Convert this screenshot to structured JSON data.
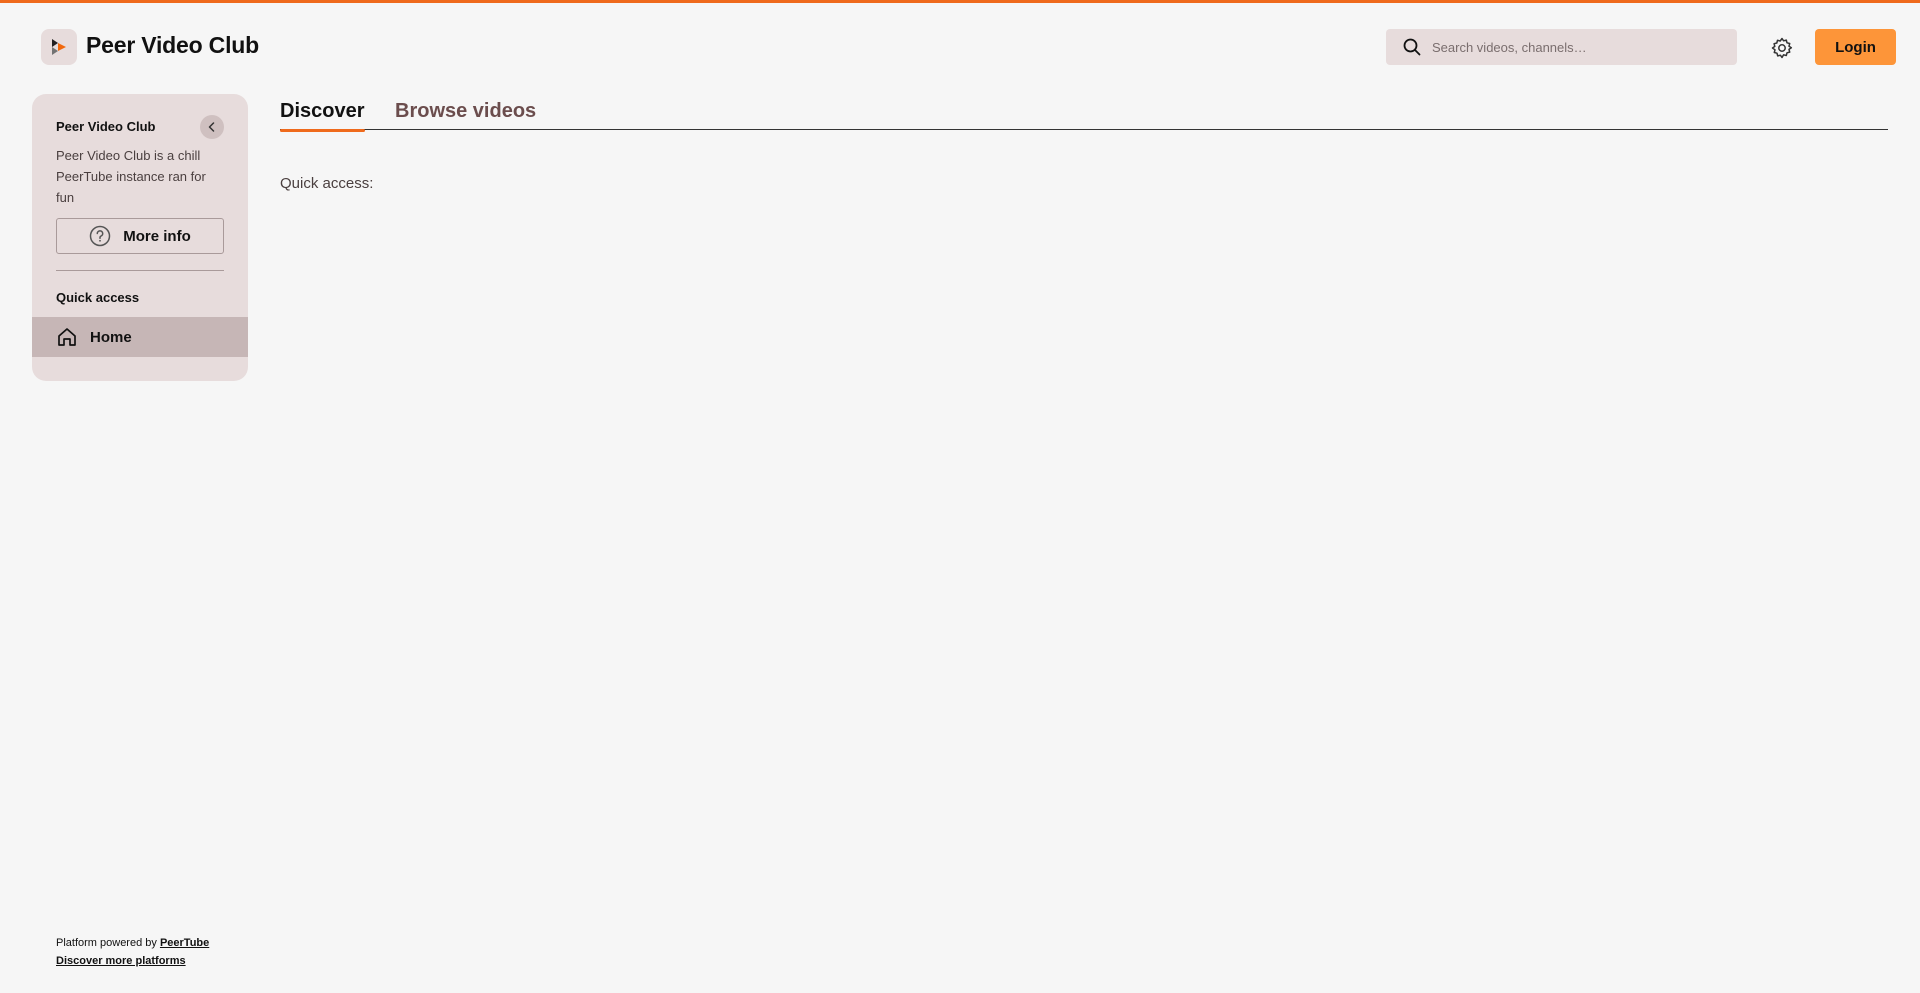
{
  "header": {
    "site_title": "Peer Video Club",
    "logo_icon": "peertube-logo-icon",
    "search": {
      "placeholder": "Search videos, channels…",
      "value": "",
      "icon": "search-icon"
    },
    "settings_icon": "gear-icon",
    "login_label": "Login"
  },
  "sidebar": {
    "instance_name": "Peer Video Club",
    "description": "Peer Video Club is a chill PeerTube instance ran for fun",
    "more_info_label": "More info",
    "section_title": "Quick access",
    "items": [
      {
        "label": "Home",
        "icon": "home-icon",
        "active": true
      }
    ]
  },
  "main": {
    "tabs": [
      {
        "label": "Discover",
        "active": true
      },
      {
        "label": "Browse videos",
        "active": false
      }
    ],
    "quick_access_label": "Quick access:"
  },
  "footer": {
    "powered_prefix": "Platform powered by ",
    "powered_link": "PeerTube",
    "discover_link": "Discover more platforms"
  },
  "colors": {
    "accent": "#ef6a1c",
    "login_button": "#fd9539",
    "sidebar_bg": "#e7dcdc",
    "sidebar_active": "#c6b6b6",
    "page_bg": "#f6f6f6"
  }
}
